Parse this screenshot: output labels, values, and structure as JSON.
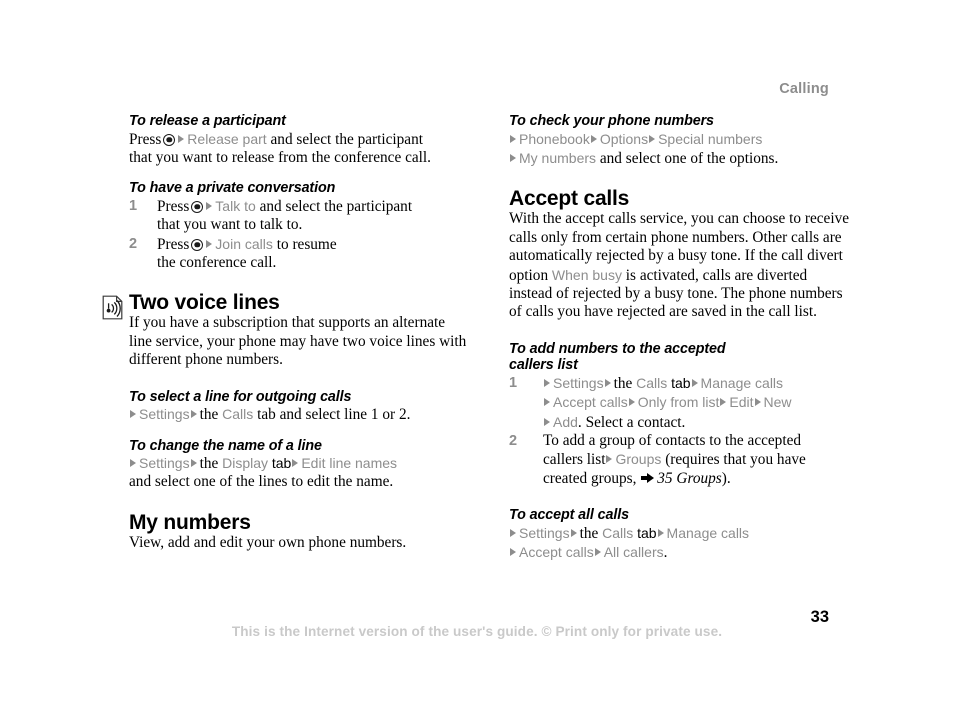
{
  "header": {
    "running_head": "Calling"
  },
  "footer": {
    "note": "This is the Internet version of the user's guide. © Print only for private use.",
    "page_number": "33"
  },
  "left_column": {
    "release_participant": {
      "heading": "To release a participant",
      "line1_pre": "Press",
      "line1_ui": "Release part",
      "line1_post": "and select the participant",
      "line2": "that you want to release from the conference call."
    },
    "private_conversation": {
      "heading": "To have a private conversation",
      "steps": [
        {
          "number": "1",
          "pre": "Press",
          "ui": "Talk to",
          "post": "and select the participant",
          "line2": "that you want to talk to."
        },
        {
          "number": "2",
          "pre": "Press",
          "ui": "Join calls",
          "post": "to resume",
          "line2": "the conference call."
        }
      ]
    },
    "two_voice_lines": {
      "icon": "voice-line-signal-icon",
      "heading": "Two voice lines",
      "body": "If you have a subscription that supports an alternate line service, your phone may have two voice lines with different phone numbers."
    },
    "select_line": {
      "heading": "To select a line for outgoing calls",
      "ui1": "Settings",
      "mid": "the",
      "ui2": "Calls",
      "post": "tab and select line 1 or 2."
    },
    "change_line_name": {
      "heading": "To change the name of a line",
      "ui1": "Settings",
      "mid": "the",
      "ui2": "Display",
      "mid2": "tab",
      "ui3": "Edit line names",
      "line2": "and select one of the lines to edit the name."
    },
    "my_numbers": {
      "heading": "My numbers",
      "body": "View, add and edit your own phone numbers."
    }
  },
  "right_column": {
    "check_phone_numbers": {
      "heading": "To check your phone numbers",
      "ui1": "Phonebook",
      "ui2": "Options",
      "ui3": "Special numbers",
      "ui4": "My numbers",
      "post": "and select one of the options."
    },
    "accept_calls": {
      "heading": "Accept calls",
      "body_part1": "With the accept calls service, you can choose to receive calls only from certain phone numbers. Other calls are automatically rejected by a busy tone. If the call divert option",
      "body_ui": "When busy",
      "body_part2": "is activated, calls are diverted instead of rejected by a busy tone. The phone numbers of calls you have rejected are saved in the call list."
    },
    "add_accepted_callers": {
      "heading_line1": "To add numbers to the accepted",
      "heading_line2": "callers list",
      "step1": {
        "number": "1",
        "ui1": "Settings",
        "mid": "the",
        "ui2": "Calls",
        "mid2": "tab",
        "ui3": "Manage calls",
        "ui4": "Accept calls",
        "ui5": "Only from list",
        "ui6": "Edit",
        "ui7": "New",
        "ui8": "Add",
        "post": ". Select a contact."
      },
      "step2": {
        "number": "2",
        "line1": "To add a group of contacts to the accepted",
        "line2_pre": "callers list",
        "line2_ui": "Groups",
        "line2_post": "(requires that you have",
        "line3_pre": "created groups,",
        "xref": "35 Groups",
        "line3_post": ")."
      }
    },
    "accept_all_calls": {
      "heading": "To accept all calls",
      "ui1": "Settings",
      "mid": "the",
      "ui2": "Calls",
      "mid2": "tab",
      "ui3": "Manage calls",
      "ui4": "Accept calls",
      "ui5": "All callers",
      "post": "."
    }
  }
}
